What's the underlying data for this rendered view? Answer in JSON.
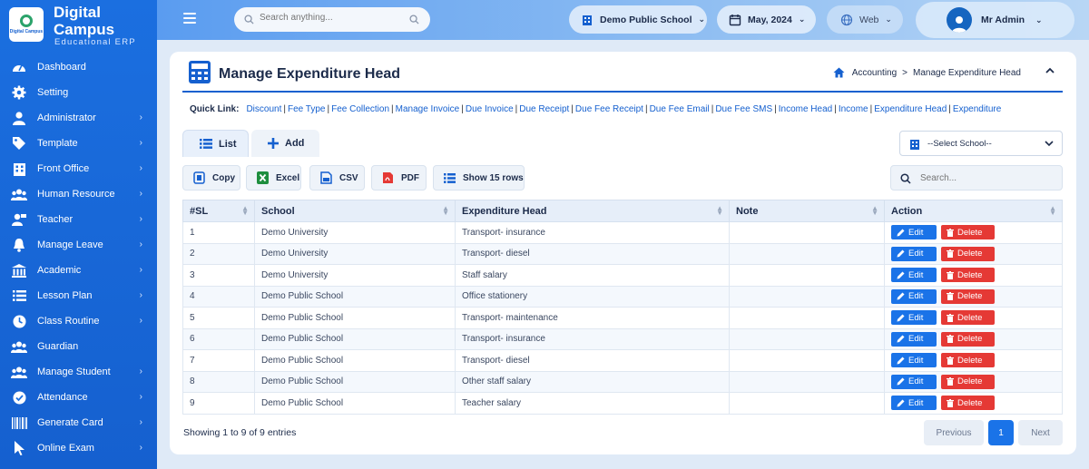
{
  "brand": {
    "title": "Digital Campus",
    "subtitle": "Educational ERP",
    "logo_text": "Digital Campus"
  },
  "sidebar": {
    "items": [
      {
        "label": "Dashboard",
        "icon": "speedometer-icon",
        "chevron": false
      },
      {
        "label": "Setting",
        "icon": "gear-icon",
        "chevron": false
      },
      {
        "label": "Administrator",
        "icon": "user-icon",
        "chevron": true
      },
      {
        "label": "Template",
        "icon": "tag-icon",
        "chevron": true
      },
      {
        "label": "Front Office",
        "icon": "building-icon",
        "chevron": true
      },
      {
        "label": "Human Resource",
        "icon": "users-icon",
        "chevron": true
      },
      {
        "label": "Teacher",
        "icon": "teacher-icon",
        "chevron": true
      },
      {
        "label": "Manage Leave",
        "icon": "bell-icon",
        "chevron": true
      },
      {
        "label": "Academic",
        "icon": "institution-icon",
        "chevron": true
      },
      {
        "label": "Lesson Plan",
        "icon": "list-icon",
        "chevron": true
      },
      {
        "label": "Class Routine",
        "icon": "clock-icon",
        "chevron": true
      },
      {
        "label": "Guardian",
        "icon": "users-icon",
        "chevron": false
      },
      {
        "label": "Manage Student",
        "icon": "users-icon",
        "chevron": true
      },
      {
        "label": "Attendance",
        "icon": "check-circle-icon",
        "chevron": true
      },
      {
        "label": "Generate Card",
        "icon": "barcode-icon",
        "chevron": true
      },
      {
        "label": "Online Exam",
        "icon": "cursor-icon",
        "chevron": true
      }
    ]
  },
  "topbar": {
    "search_placeholder": "Search anything...",
    "school": "Demo Public School",
    "date": "May, 2024",
    "web": "Web",
    "user": "Mr Admin"
  },
  "page": {
    "title": "Manage Expenditure Head",
    "breadcrumb": [
      "Accounting",
      "Manage Expenditure Head"
    ],
    "quick_link_label": "Quick Link:",
    "quick_links": [
      "Discount",
      "Fee Type",
      "Fee Collection",
      "Manage Invoice",
      "Due Invoice",
      "Due Receipt",
      "Due Fee Receipt",
      "Due Fee Email",
      "Due Fee SMS",
      "Income Head",
      "Income",
      "Expenditure Head",
      "Expenditure"
    ],
    "tabs": {
      "list": "List",
      "add": "Add"
    },
    "select_school": "--Select School--",
    "buttons": {
      "copy": "Copy",
      "excel": "Excel",
      "csv": "CSV",
      "pdf": "PDF",
      "show_rows": "Show 15 rows"
    },
    "table_search_placeholder": "Search..."
  },
  "table": {
    "headers": [
      "#SL",
      "School",
      "Expenditure Head",
      "Note",
      "Action"
    ],
    "edit_label": "Edit",
    "delete_label": "Delete",
    "rows": [
      {
        "sl": "1",
        "school": "Demo University",
        "head": "Transport- insurance",
        "note": ""
      },
      {
        "sl": "2",
        "school": "Demo University",
        "head": "Transport- diesel",
        "note": ""
      },
      {
        "sl": "3",
        "school": "Demo University",
        "head": "Staff salary",
        "note": ""
      },
      {
        "sl": "4",
        "school": "Demo Public School",
        "head": "Office stationery",
        "note": ""
      },
      {
        "sl": "5",
        "school": "Demo Public School",
        "head": "Transport- maintenance",
        "note": ""
      },
      {
        "sl": "6",
        "school": "Demo Public School",
        "head": "Transport- insurance",
        "note": ""
      },
      {
        "sl": "7",
        "school": "Demo Public School",
        "head": "Transport- diesel",
        "note": ""
      },
      {
        "sl": "8",
        "school": "Demo Public School",
        "head": "Other staff salary",
        "note": ""
      },
      {
        "sl": "9",
        "school": "Demo Public School",
        "head": "Teacher salary",
        "note": ""
      }
    ]
  },
  "pagination": {
    "info": "Showing 1 to 9 of 9 entries",
    "previous": "Previous",
    "current": "1",
    "next": "Next"
  },
  "colors": {
    "primary": "#1560cf",
    "edit": "#1a73e8",
    "delete": "#e53935",
    "sidebar": "#1b6fe0"
  }
}
